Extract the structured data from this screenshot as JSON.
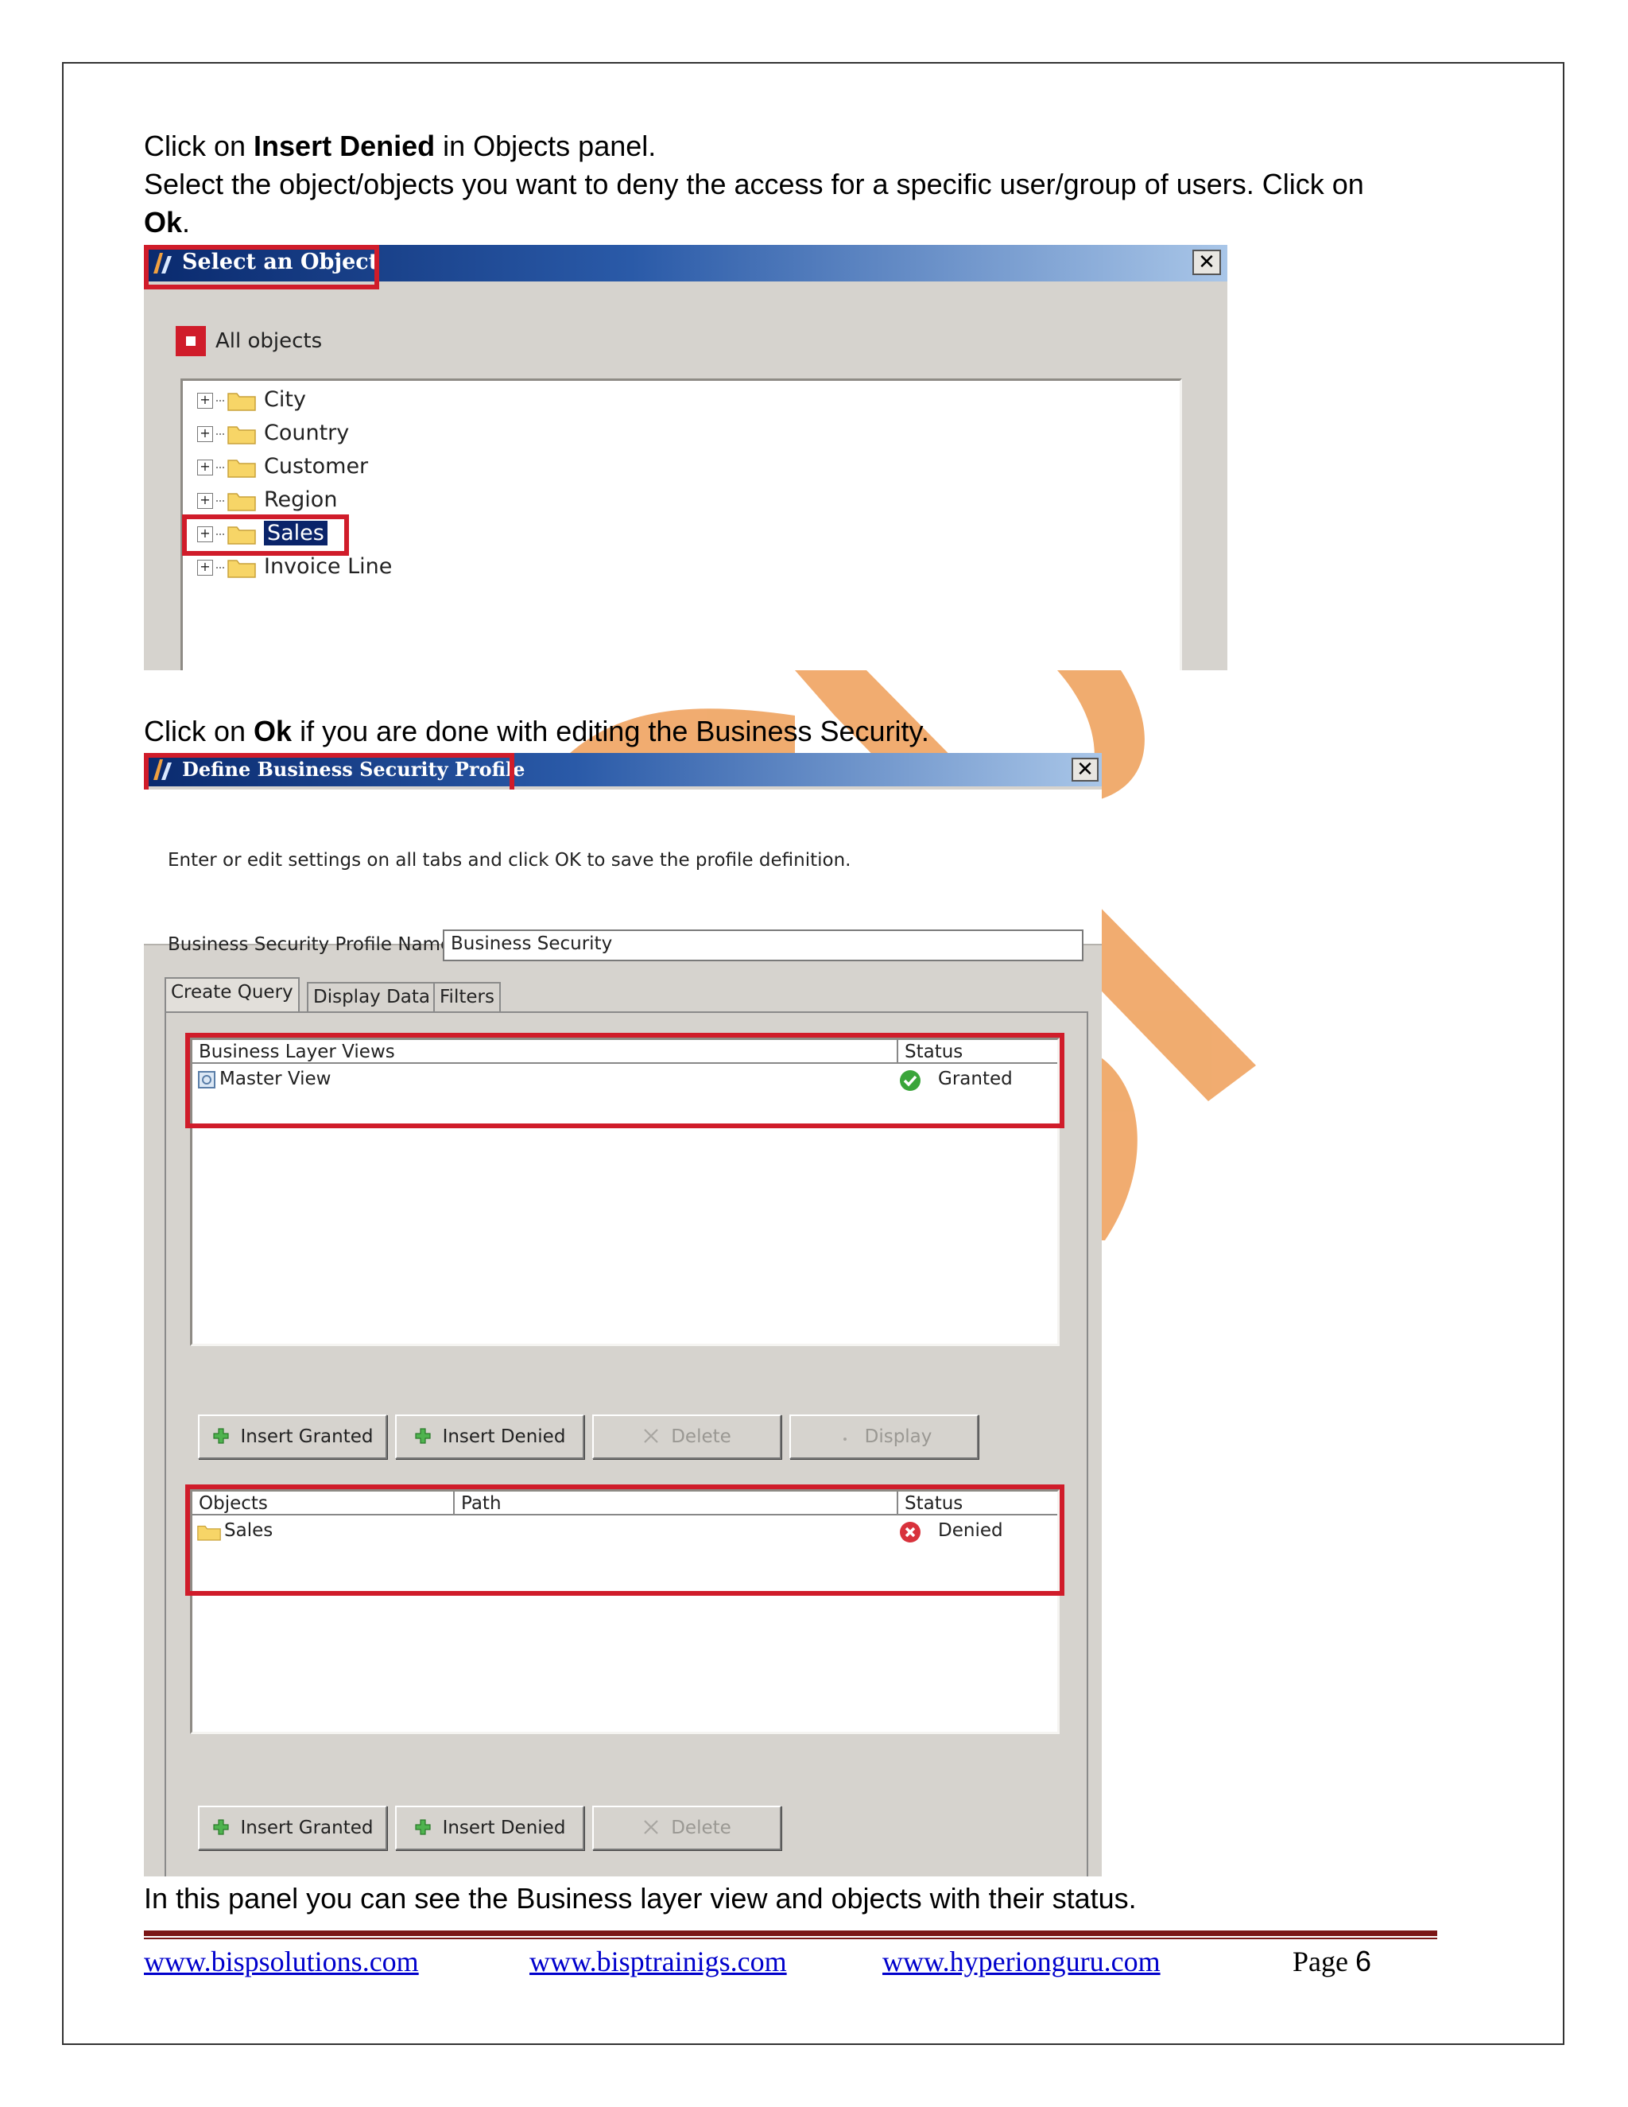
{
  "intro": {
    "line1_pre": "Click on ",
    "line1_bold": "Insert Denied",
    "line1_post": " in Objects panel.",
    "line2": "Select the object/objects you want to deny the access for a specific user/group of users. Click on",
    "line3_bold": "Ok",
    "line3_post": "."
  },
  "select_dialog": {
    "title": "Select an Object",
    "close": "✕",
    "root_label": "All objects",
    "tree_items": [
      "City",
      "Country",
      "Customer",
      "Region",
      "Sales",
      "Invoice Line"
    ],
    "selected_item": "Sales"
  },
  "middle_text": {
    "pre": "Click on ",
    "bold": "Ok",
    "post": " if you are done with editing the Business Security."
  },
  "profile_dialog": {
    "title": "Define Business Security Profile",
    "close": "✕",
    "instruction": "Enter or edit settings on all tabs and click OK to save the profile definition.",
    "name_label": "Business Security Profile Name",
    "name_value": "Business Security",
    "tabs": [
      "Create Query",
      "Display Data",
      "Filters"
    ],
    "views_table": {
      "headers": [
        "Business Layer Views",
        "Status"
      ],
      "rows": [
        {
          "name": "Master View",
          "status": "Granted"
        }
      ]
    },
    "views_buttons": [
      "Insert Granted",
      "Insert Denied",
      "Delete",
      "Display"
    ],
    "objects_table": {
      "headers": [
        "Objects",
        "Path",
        "Status"
      ],
      "rows": [
        {
          "name": "Sales",
          "path": "",
          "status": "Denied"
        }
      ]
    },
    "objects_buttons": [
      "Insert Granted",
      "Insert Denied",
      "Delete"
    ]
  },
  "closing_text": "In this panel you can see the Business layer view and objects with their status.",
  "footer": {
    "links": [
      "www.bispsolutions.com",
      "www.bisptrainigs.com",
      "www.hyperionguru.com"
    ],
    "page_label": "Page",
    "page_number": "6"
  },
  "colors": {
    "highlight_red": "#d01c2a",
    "watermark_orange": "#f0a868",
    "footer_rule": "#7b1616",
    "link_blue": "#0000cc"
  }
}
